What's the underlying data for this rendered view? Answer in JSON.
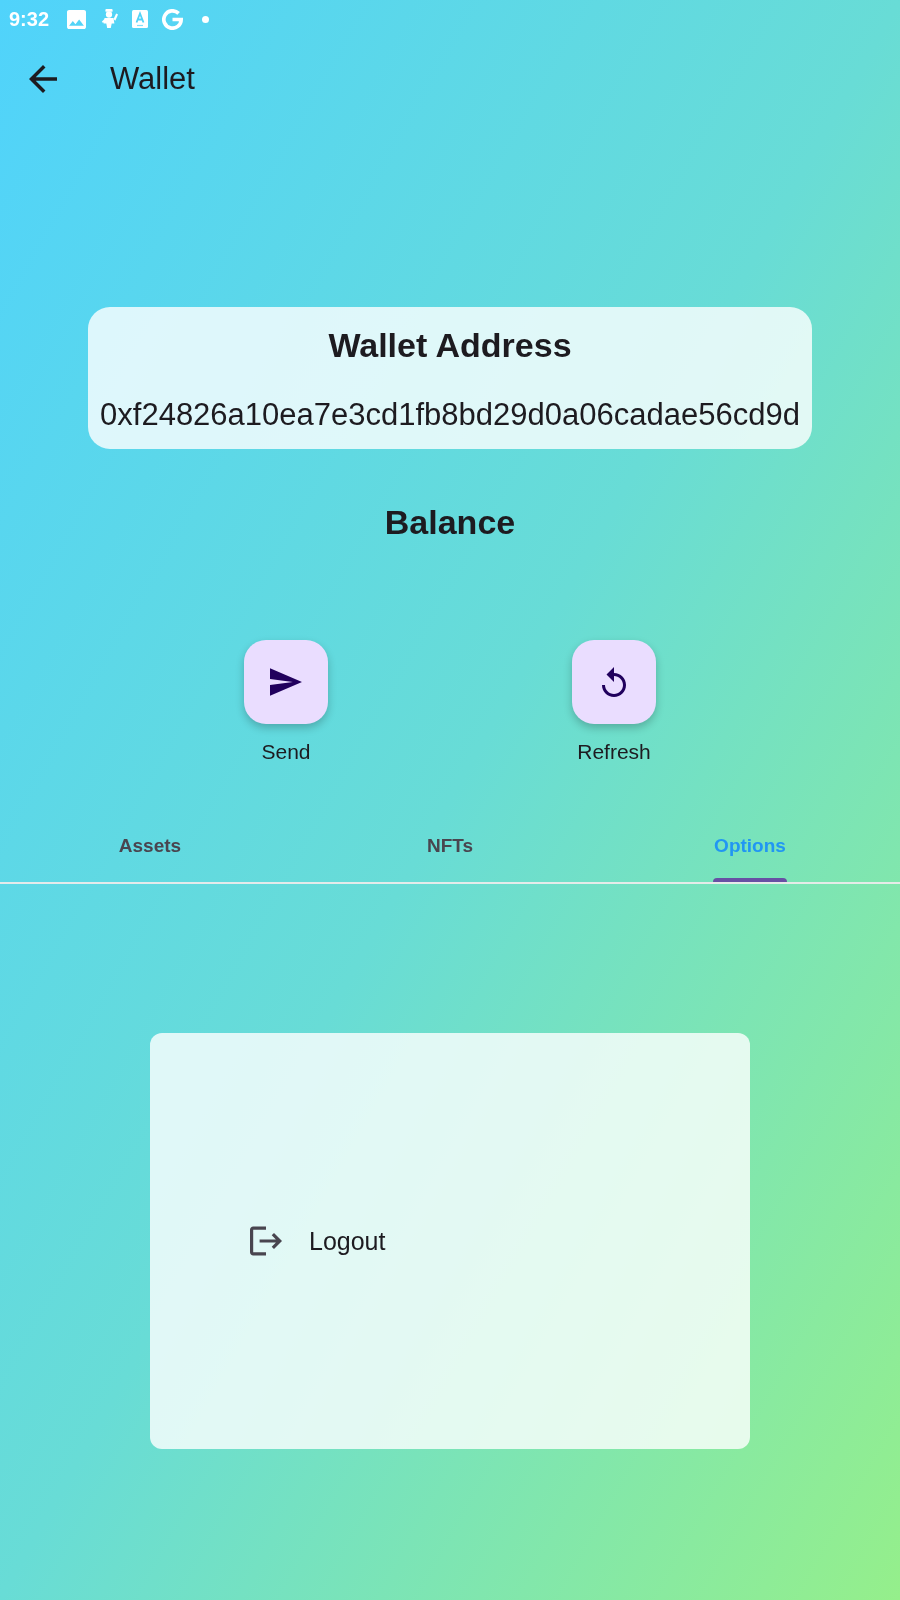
{
  "status_bar": {
    "time": "9:32"
  },
  "app_bar": {
    "title": "Wallet"
  },
  "address_card": {
    "title": "Wallet Address",
    "address": "0xf24826a10ea7e3cd1fb8bd29d0a06cadae56cd9d"
  },
  "balance": {
    "title": "Balance"
  },
  "actions": [
    {
      "kind": "send",
      "label": "Send"
    },
    {
      "kind": "refresh",
      "label": "Refresh"
    }
  ],
  "tabs": [
    {
      "label": "Assets",
      "selected": false
    },
    {
      "label": "NFTs",
      "selected": false
    },
    {
      "label": "Options",
      "selected": true
    }
  ],
  "options_card": {
    "items": [
      {
        "kind": "logout",
        "label": "Logout"
      }
    ]
  }
}
